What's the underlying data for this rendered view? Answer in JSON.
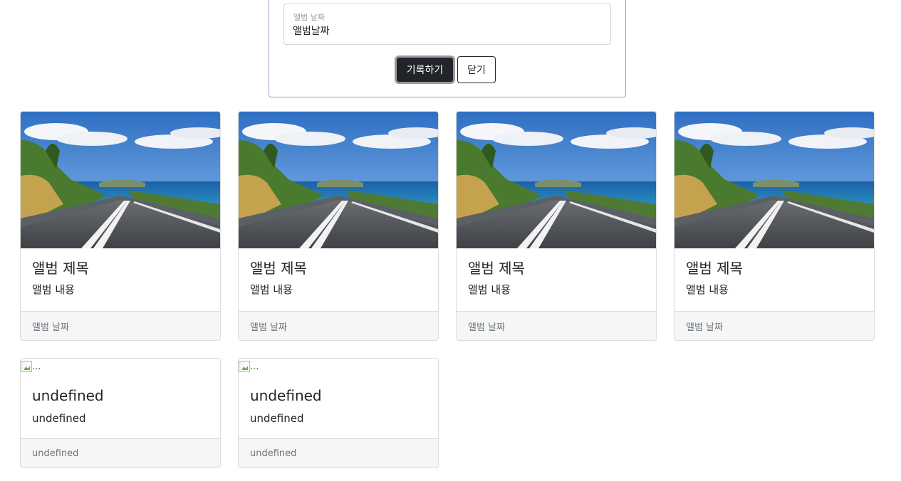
{
  "form": {
    "date_label": "앨범 날짜",
    "date_value": "앨범날짜",
    "submit_label": "기록하기",
    "close_label": "닫기"
  },
  "cards": [
    {
      "title": "앨범 제목",
      "text": "앨범 내용",
      "date": "앨범 날짜"
    },
    {
      "title": "앨범 제목",
      "text": "앨범 내용",
      "date": "앨범 날짜"
    },
    {
      "title": "앨범 제목",
      "text": "앨범 내용",
      "date": "앨범 날짜"
    },
    {
      "title": "앨범 제목",
      "text": "앨범 내용",
      "date": "앨범 날짜"
    },
    {
      "title": "undefined",
      "text": "undefined",
      "date": "undefined",
      "img_alt": "..."
    },
    {
      "title": "undefined",
      "text": "undefined",
      "date": "undefined",
      "img_alt": "..."
    }
  ],
  "colors": {
    "panel_border": "#9b9cf2",
    "primary_button": "#212529",
    "footer_bg": "#f6f6f6"
  }
}
